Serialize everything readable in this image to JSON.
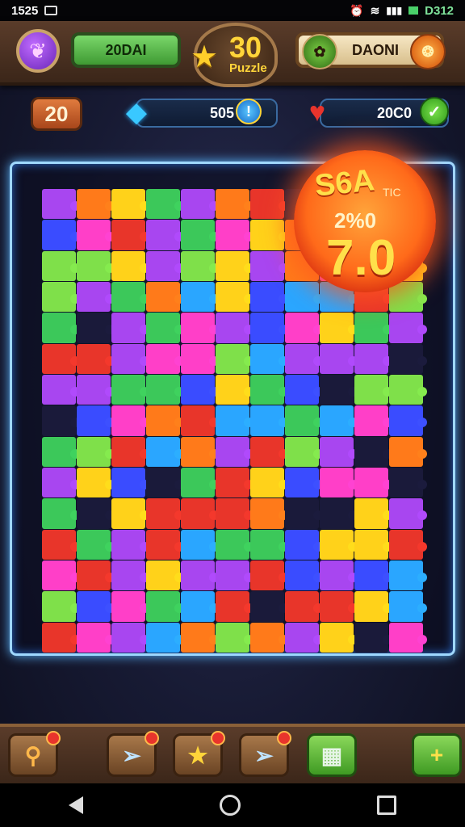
{
  "status_bar": {
    "time_left": "1525",
    "time_right": "D312"
  },
  "header": {
    "left_pill_label": "20DAI",
    "level_number": "30",
    "level_label": "Puzzle",
    "right_pill_label": "DAONI"
  },
  "stats": {
    "counter_value": "20",
    "gems_value": "505",
    "hearts_value": "20C0"
  },
  "burst": {
    "title": "S6A",
    "tag": "TIC",
    "subtitle": "2%0",
    "main_value": "7.0"
  },
  "board": {
    "colors": [
      "#e8352a",
      "#ffd21a",
      "#3cc85a",
      "#2aa6ff",
      "#a846f0",
      "#ff7a1a",
      "#ff3fc8",
      "#3a4cff",
      "#1a1a3a",
      "#7fe04a"
    ]
  },
  "toolbar": {
    "buttons": [
      {
        "name": "magnify",
        "icon": "magnify-icon"
      },
      {
        "name": "paper-plane",
        "icon": "paper-plane-icon"
      },
      {
        "name": "star",
        "icon": "star-icon"
      },
      {
        "name": "paper-plane-2",
        "icon": "paper-plane-icon"
      },
      {
        "name": "box",
        "icon": "box-icon"
      },
      {
        "name": "add",
        "icon": "plus-icon"
      }
    ]
  }
}
